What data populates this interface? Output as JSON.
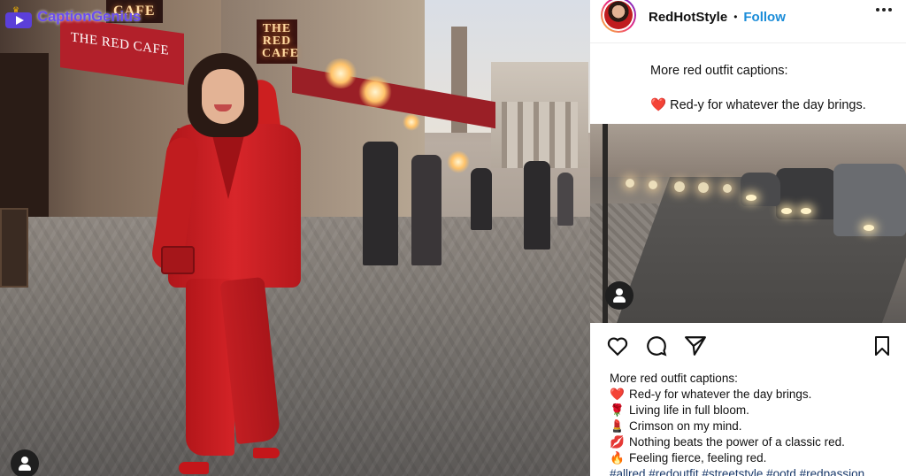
{
  "brand": {
    "name": "CaptionGenius",
    "color": "#6a4df0"
  },
  "photo": {
    "sign_top": "CAFE",
    "sign_red": "THE RED CAFE",
    "awning_text": "THE RED CAFE"
  },
  "post": {
    "username": "RedHotStyle",
    "separator": "•",
    "follow_label": "Follow",
    "caption_card": {
      "line1": "More red outfit captions:",
      "line2_emoji": "❤️",
      "line2": "Red-y for whatever the day brings."
    },
    "caption_list": {
      "heading": "More red outfit captions:",
      "items": [
        {
          "emoji": "❤️",
          "text": "Red-y for whatever the day brings."
        },
        {
          "emoji": "🌹",
          "text": "Living life in full bloom."
        },
        {
          "emoji": "💄",
          "text": "Crimson on my mind."
        },
        {
          "emoji": "💋",
          "text": "Nothing beats the power of a classic red."
        },
        {
          "emoji": "🔥",
          "text": "Feeling fierce, feeling red."
        }
      ],
      "hashtags": "#allred #redoutfit #streetstyle #ootd #redpassion"
    },
    "accent": "#1a8cd8"
  }
}
